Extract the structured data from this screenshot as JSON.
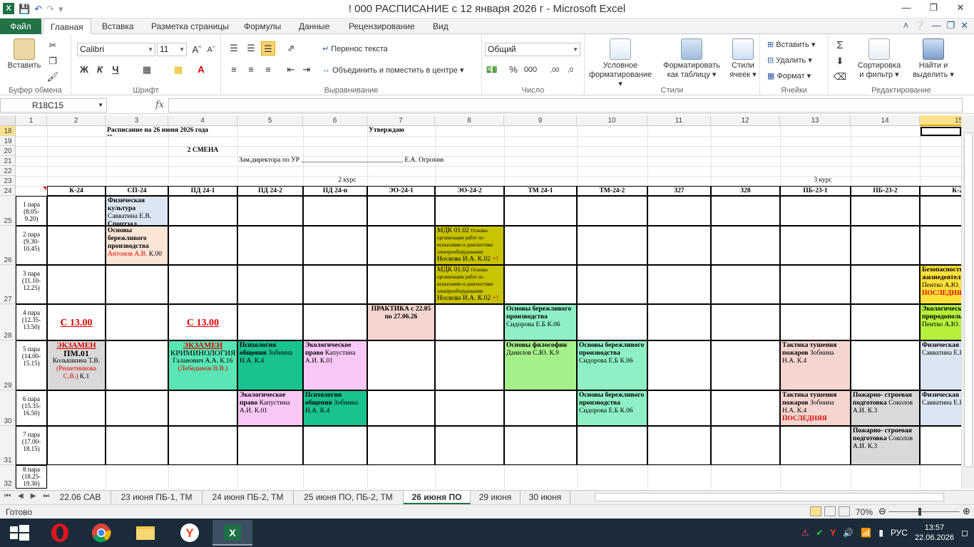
{
  "window": {
    "title": "! 000 РАСПИСАНИЕ с 12 января 2026 г  -  Microsoft Excel",
    "app_letter": "X"
  },
  "ribbon_tabs": [
    "Файл",
    "Главная",
    "Вставка",
    "Разметка страницы",
    "Формулы",
    "Данные",
    "Рецензирование",
    "Вид"
  ],
  "ribbon": {
    "clipboard": {
      "paste": "Вставить",
      "group": "Буфер обмена"
    },
    "font": {
      "name": "Calibri",
      "size": "11",
      "bold": "Ж",
      "italic": "К",
      "underline": "Ч",
      "group": "Шрифт"
    },
    "alignment": {
      "wrap": "Перенос текста",
      "merge": "Объединить и поместить в центре",
      "group": "Выравнивание"
    },
    "number": {
      "format": "Общий",
      "percent": "%",
      "thousands": "000",
      "group": "Число"
    },
    "styles": {
      "cond1": "Условное",
      "cond2": "форматирование",
      "table1": "Форматировать",
      "table2": "как таблицу",
      "cell1": "Стили",
      "cell2": "ячеек",
      "group": "Стили"
    },
    "cells": {
      "insert": "Вставить",
      "delete": "Удалить",
      "format": "Формат",
      "group": "Ячейки"
    },
    "editing": {
      "sum": "Σ",
      "sort1": "Сортировка",
      "sort2": "и фильтр",
      "find1": "Найти и",
      "find2": "выделить",
      "group": "Редактирование"
    }
  },
  "formula_bar": {
    "name_box": "R18C15",
    "fx": "fx",
    "value": ""
  },
  "columns": [
    "1",
    "2",
    "3",
    "4",
    "5",
    "6",
    "7",
    "8",
    "9",
    "10",
    "11",
    "12",
    "13",
    "14",
    "15"
  ],
  "rows": [
    "18",
    "19",
    "20",
    "21",
    "22",
    "23",
    "24",
    "25",
    "26",
    "27",
    "28",
    "29",
    "30",
    "31",
    "32"
  ],
  "header_texts": {
    "title": "Расписание на 26 июня 2026 года  Пятница",
    "approve": "Утверждаю",
    "shift": "2 СМЕНА",
    "deputy": "Зам.директора по УР ______________________________ Е.А. Огрохин",
    "course2": "2 курс",
    "course3": "3 курс"
  },
  "groups": [
    "К-24",
    "СП-24",
    "ПД 24-1",
    "ПД 24-2",
    "ПД 24-п",
    "ЭО-24-1",
    "ЭО-24-2",
    "ТМ 24-1",
    "ТМ-24-2",
    "327",
    "328",
    "ПБ-23-1",
    "ПБ-23-2",
    "К-23"
  ],
  "periods": [
    {
      "name": "1 пара",
      "time": "(8.05-9.20)"
    },
    {
      "name": "2 пара",
      "time": "(9.30-10.45)"
    },
    {
      "name": "3 пара",
      "time": "(11.10-12.25)"
    },
    {
      "name": "4 пара",
      "time": "(12.35-13.50)"
    },
    {
      "name": "5 пара",
      "time": "(14.00-15.15)"
    },
    {
      "name": "6 пара",
      "time": "(15.35-16.50)"
    },
    {
      "name": "7 пара",
      "time": "(17.00-18.15)"
    },
    {
      "name": "8 пара",
      "time": "(18.25-19.30)"
    }
  ],
  "cells": {
    "r25_sp": {
      "t1": "Физическая культура",
      "t2": "Савватина Е.В.",
      "t3": "Спортзал"
    },
    "r26_sp": {
      "t1": "Основы бережливого производства",
      "t2": "Антонов А.В.",
      "t3": "К.00"
    },
    "r26_eo": {
      "t1": "МДК 01.02",
      "t2": "Основы организации работ по испытанию и диагностике электрооборудования",
      "t3": "Носкова И.А. К.02",
      "t4": "+!"
    },
    "r27_eo": {
      "t1": "МДК 01.02",
      "t2": "Основы организации работ по испытанию и диагностике электрооборудования",
      "t3": "Носкова И.А. К.02",
      "t4": "+!"
    },
    "r27_k23": {
      "t1": "Безопасность жизнедеятельности",
      "t2": "Пентко А.Ю.",
      "t3": "ПОСЛЕДНЯЯ"
    },
    "r28_k24": {
      "t1": "С 13.00"
    },
    "r28_pd": {
      "t1": "С 13.00"
    },
    "r28_eo1": {
      "t1": "ПРАКТИКА  с 22.05 по 27.06.26"
    },
    "r28_tm1": {
      "t1": "Основы бережливого производства",
      "t2": "Сидорова Е.Б К.06"
    },
    "r28_k23": {
      "t1": "Экологические основы природопользования",
      "t2": "Пентко А.Ю."
    },
    "r29_k24": {
      "t1": "ЭКЗАМЕН",
      "t2": "ПМ.01",
      "t3": "Колышкина Т.В.",
      "t4": "(Решетникова С.В.)",
      "t5": "К.1"
    },
    "r29_pd1": {
      "t1": "ЭКЗАМЕН",
      "t2": "КРИМИНОЛОГИЯ",
      "t3": "Галанович А.А. К.16",
      "t4": "(Лебединов В.В.)"
    },
    "r29_pd2": {
      "t1": "Психология общения",
      "t2": "Зобнина Н.А. К.4"
    },
    "r29_pdp": {
      "t1": "Экологическое право",
      "t2": "Капустина А.И. К.01"
    },
    "r29_tm1": {
      "t1": "Основы философии",
      "t2": "Данилов С.Ю. К.9"
    },
    "r29_tm2": {
      "t1": "Основы бережливого производства",
      "t2": "Сидорова Е.Б К.06"
    },
    "r29_pb1": {
      "t1": "Тактика тушения пожаров",
      "t2": "Зобнина Н.А. К.4"
    },
    "r29_k23": {
      "t1": "Физическая культура",
      "t2": "Савватина Е.В. Спортзал"
    },
    "r30_pd2": {
      "t1": "Экологическое право",
      "t2": "Капустина А.И. К.01"
    },
    "r30_pdp": {
      "t1": "Психология общения",
      "t2": "Зобнина Н.А. К.4"
    },
    "r30_tm2": {
      "t1": "Основы бережливого производства",
      "t2": "Сидорова Е.Б К.06"
    },
    "r30_pb1": {
      "t1": "Тактика тушения пожаров",
      "t2": "Зобнина Н.А. К.4",
      "t3": "ПОСЛЕДНЯЯ"
    },
    "r30_pb2": {
      "t1": "Пожарно- строевая подготовка",
      "t2": "Соколов А.И. К.3"
    },
    "r30_k23": {
      "t1": "Физическая культура",
      "t2": "Савватина Е.В. Спортзал"
    },
    "r31_pb2": {
      "t1": "Пожарно- строевая подготовка",
      "t2": "Соколов А.И. К.3"
    }
  },
  "sheet_tabs": [
    "22.06 САВ",
    "23 июня ПБ-1, ТМ",
    "24 июня ПБ-2, ТМ",
    "25 июня ПО, ПБ-2, ТМ",
    "26 июня ПО",
    "29 июня",
    "30 июня"
  ],
  "status": {
    "ready": "Готово",
    "zoom": "70%"
  },
  "taskbar": {
    "lang": "РУС",
    "time": "13:57",
    "date": "22.06.2026"
  },
  "colors": {
    "excel_green": "#217346",
    "peach": "#fbe5d6",
    "olive": "#c9c400",
    "mint": "#59e6b4",
    "teal": "#19c28e",
    "pink": "#f9c8f7",
    "lightgreen": "#a6f08a",
    "light_mint": "#8ff0c6",
    "salmon": "#f4d5cf",
    "gray": "#d9d9d9",
    "lightblue": "#dce6f2",
    "yellowgreen": "#b6f03c"
  }
}
